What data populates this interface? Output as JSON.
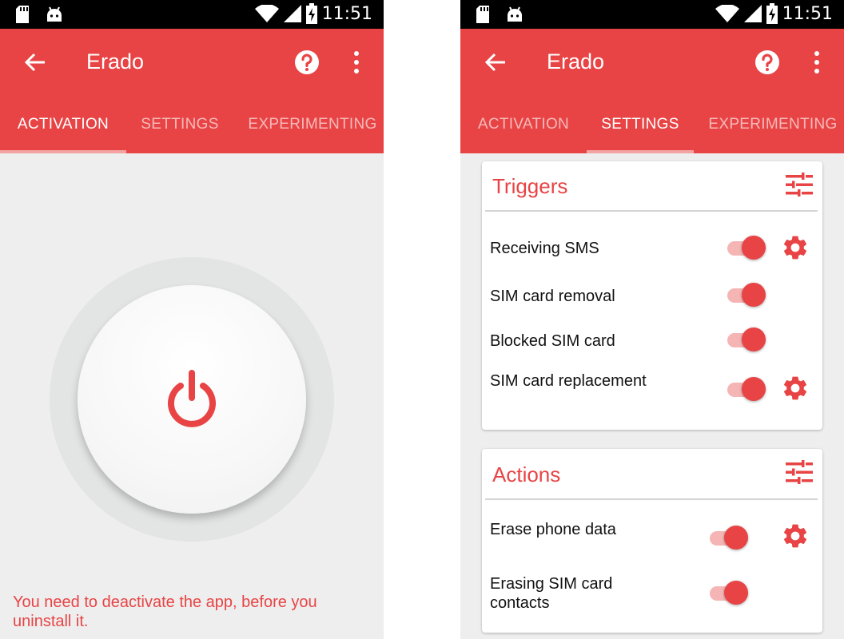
{
  "colors": {
    "accent": "#e84445",
    "track": "#f5b5b5",
    "background": "#eeeeee"
  },
  "status_bar": {
    "time": "11:51",
    "icons": [
      "sd-card-icon",
      "android-icon",
      "wifi-icon",
      "signal-icon",
      "battery-charging-icon"
    ]
  },
  "app_bar": {
    "title": "Erado",
    "icons": [
      "back-arrow-icon",
      "help-icon",
      "more-vert-icon"
    ]
  },
  "tabs": [
    {
      "label": "ACTIVATION"
    },
    {
      "label": "SETTINGS"
    },
    {
      "label": "EXPERIMENTING"
    }
  ],
  "activation": {
    "power_icon": "power-icon",
    "warning": "You need to deactivate the app, before you uninstall it."
  },
  "settings": {
    "triggers": {
      "title": "Triggers",
      "icon": "tune-icon",
      "rows": [
        {
          "label": "Receiving SMS",
          "on": true,
          "has_settings": true
        },
        {
          "label": "SIM card removal",
          "on": true,
          "has_settings": false
        },
        {
          "label": "Blocked SIM card",
          "on": true,
          "has_settings": false
        },
        {
          "label": "SIM card replacement",
          "on": true,
          "has_settings": true
        }
      ]
    },
    "actions": {
      "title": "Actions",
      "icon": "tune-icon",
      "rows": [
        {
          "label": "Erase phone data",
          "on": true,
          "has_settings": true
        },
        {
          "label": "Erasing SIM card contacts",
          "on": true,
          "has_settings": false
        }
      ]
    }
  }
}
